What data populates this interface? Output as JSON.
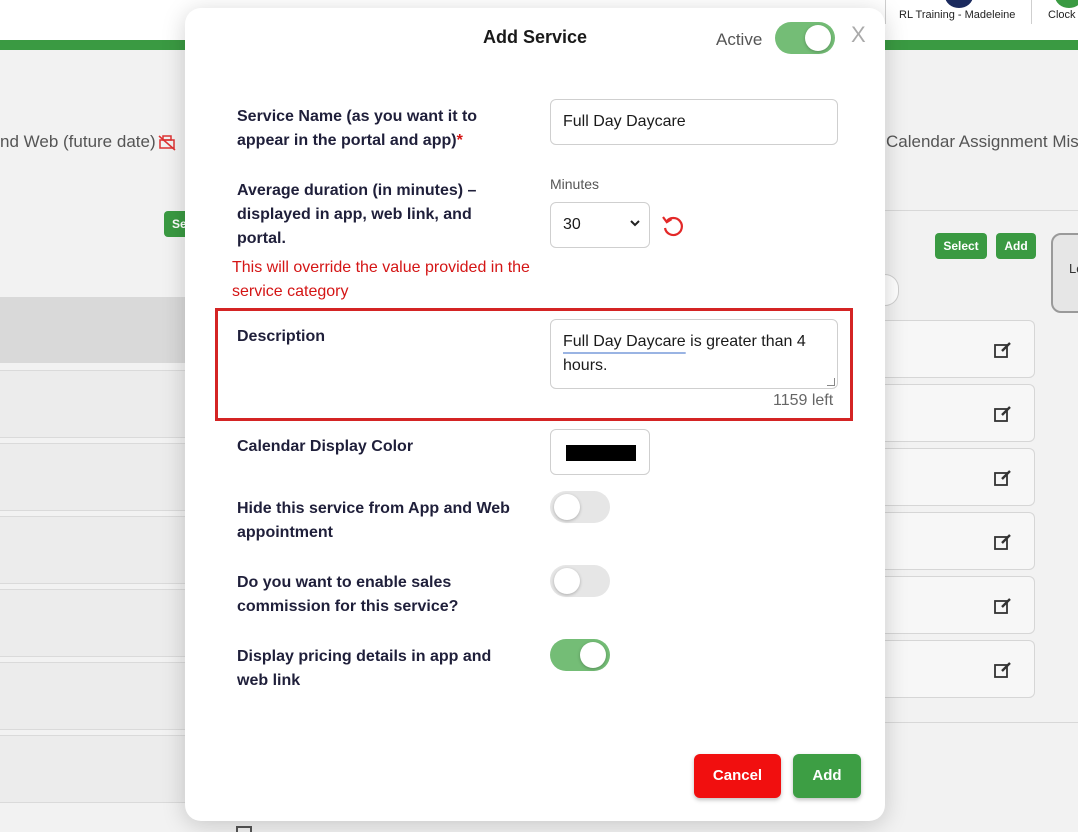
{
  "background": {
    "users": [
      "RL Training - Madeleine",
      "Clock"
    ],
    "left_text": "nd Web (future date)",
    "right_text": "Calendar Assignment Miss",
    "select_button": "Select",
    "add_button": "Add",
    "left_button_fragment": "Se",
    "side_tab_fragment": "Lo",
    "accent_color": "#3a9a42"
  },
  "modal": {
    "title": "Add Service",
    "active_label": "Active",
    "active_on": true,
    "close_label": "X",
    "service_name": {
      "label": "Service Name (as you want it to appear in the portal and app)",
      "required_mark": "*",
      "value": "Full Day Daycare"
    },
    "duration": {
      "label": "Average duration (in minutes) – displayed in app, web link, and portal.",
      "caption": "Minutes",
      "value": "30",
      "warning": "This will override the value provided in the service category"
    },
    "description": {
      "label": "Description",
      "value_underlined": "Full Day Daycare",
      "value_rest": " is greater than 4 hours.",
      "chars_left": "1159 left"
    },
    "calendar_color": {
      "label": "Calendar Display Color",
      "value": "#000000"
    },
    "hide_service": {
      "label": "Hide this service from App and Web appointment",
      "on": false
    },
    "sales_commission": {
      "label": "Do you want to enable sales commission for this service?",
      "on": false
    },
    "display_pricing": {
      "label": "Display pricing details in app and web link",
      "on": true
    },
    "cancel_label": "Cancel",
    "add_label": "Add",
    "colors": {
      "cancel": "#f10f0f",
      "add": "#3d9e44",
      "toggle_on": "#74bd76",
      "warning": "#d41515",
      "highlight": "#d42424"
    }
  }
}
